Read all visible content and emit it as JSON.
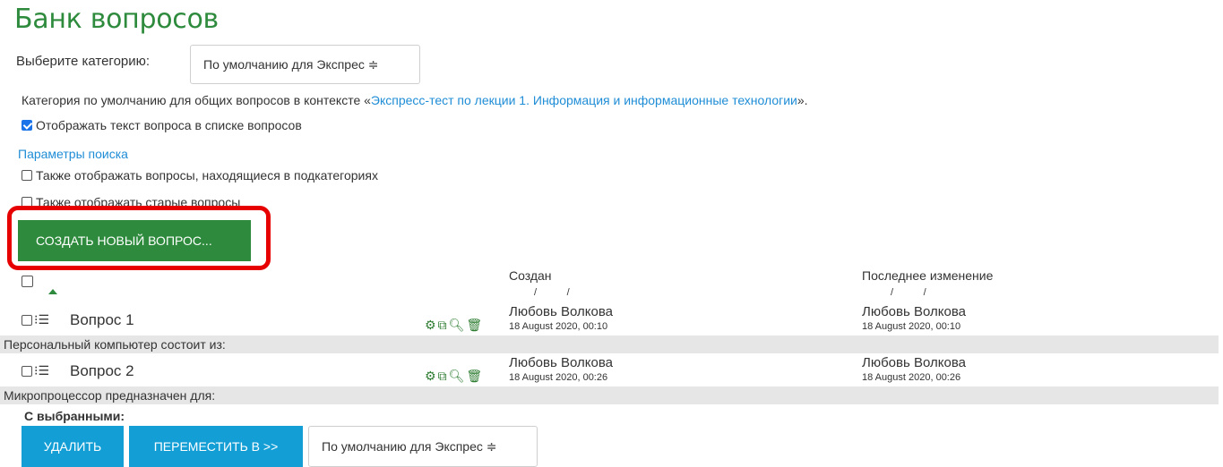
{
  "page_title": "Банк вопросов",
  "category_select": {
    "label": "Выберите категорию:",
    "value": "По умолчанию для Экспрес ≑"
  },
  "category_info": {
    "prefix": "Категория по умолчанию для общих вопросов в контексте «",
    "link": "Экспресс-тест по лекции 1. Информация и информационные технологии",
    "suffix": "»."
  },
  "show_text_checkbox": {
    "label": "Отображать текст вопроса в списке вопросов",
    "checked": true
  },
  "search_params_link": "Параметры поиска",
  "subcategories_checkbox": {
    "label": "Также отображать вопросы, находящиеся в подкатегориях",
    "checked": false
  },
  "old_questions_checkbox": {
    "label": "Также отображать старые вопросы",
    "checked": false
  },
  "create_button": "Создать новый вопрос...",
  "table": {
    "created_header": "Создан",
    "modified_header": "Последнее изменение",
    "sort_slashes": "/           /",
    "rows": [
      {
        "name": "Вопрос 1",
        "created_by": "Любовь Волкова",
        "created_date": "18 August 2020, 00:10",
        "modified_by": "Любовь Волкова",
        "modified_date": "18 August 2020, 00:10",
        "text": "Персональный компьютер состоит из:"
      },
      {
        "name": "Вопрос 2",
        "created_by": "Любовь Волкова",
        "created_date": "18 August 2020, 00:26",
        "modified_by": "Любовь Волкова",
        "modified_date": "18 August 2020, 00:26",
        "text": "Микропроцессор предназначен для:"
      }
    ]
  },
  "with_selected_label": "С выбранными:",
  "delete_button": "Удалить",
  "move_button": "Переместить в >>",
  "move_select_value": "По умолчанию для Экспрес ≑",
  "icons": [
    "gear-icon",
    "copy-icon",
    "preview-icon",
    "trash-icon"
  ],
  "colors": {
    "accent": "#2e8b3d",
    "primary": "#139ed6",
    "highlight": "#e60000"
  }
}
